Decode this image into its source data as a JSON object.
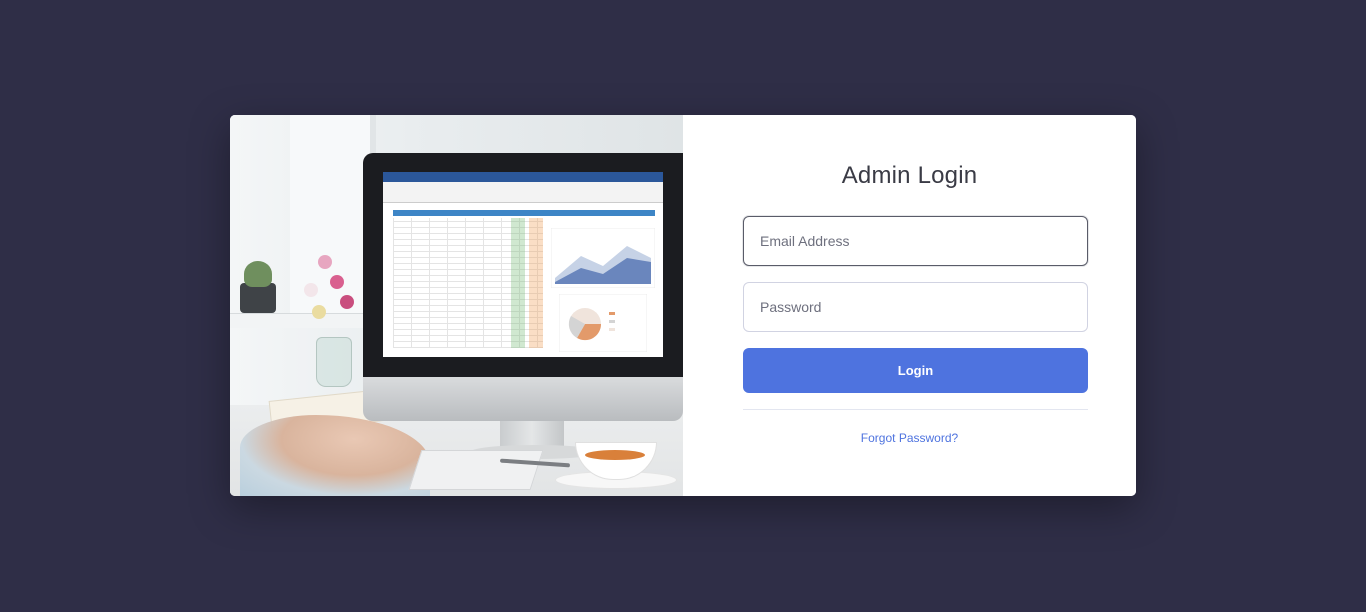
{
  "login": {
    "title": "Admin Login",
    "email_placeholder": "Email Address",
    "email_value": "",
    "password_placeholder": "Password",
    "password_value": "",
    "login_button_label": "Login",
    "forgot_password_label": "Forgot Password?"
  },
  "illustration": {
    "icon": "office-computer-spreadsheet-photo"
  },
  "colors": {
    "page_background": "#2f2e47",
    "card_background": "#ffffff",
    "primary_button": "#4e73df",
    "link": "#4e73df",
    "title_text": "#3a3b45"
  }
}
